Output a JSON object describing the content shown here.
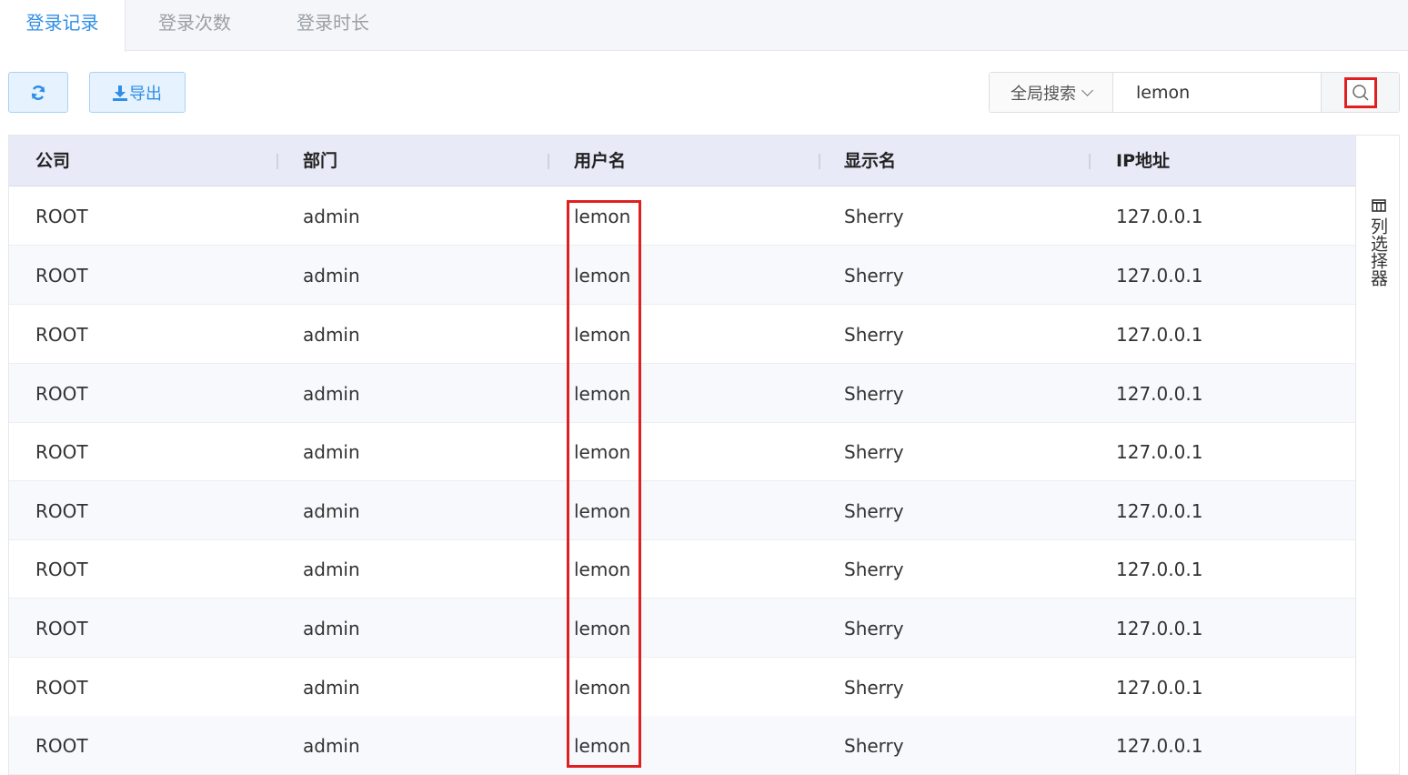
{
  "tabs": [
    {
      "label": "登录记录",
      "active": true
    },
    {
      "label": "登录次数",
      "active": false
    },
    {
      "label": "登录时长",
      "active": false
    }
  ],
  "toolbar": {
    "refresh_icon": "refresh-icon",
    "export_icon": "download-icon",
    "export_label": "导出"
  },
  "search": {
    "scope_label": "全局搜索",
    "value": "lemon",
    "search_icon": "search-icon"
  },
  "table": {
    "columns": [
      "公司",
      "部门",
      "用户名",
      "显示名",
      "IP地址"
    ],
    "rows": [
      [
        "ROOT",
        "admin",
        "lemon",
        "Sherry",
        "127.0.0.1"
      ],
      [
        "ROOT",
        "admin",
        "lemon",
        "Sherry",
        "127.0.0.1"
      ],
      [
        "ROOT",
        "admin",
        "lemon",
        "Sherry",
        "127.0.0.1"
      ],
      [
        "ROOT",
        "admin",
        "lemon",
        "Sherry",
        "127.0.0.1"
      ],
      [
        "ROOT",
        "admin",
        "lemon",
        "Sherry",
        "127.0.0.1"
      ],
      [
        "ROOT",
        "admin",
        "lemon",
        "Sherry",
        "127.0.0.1"
      ],
      [
        "ROOT",
        "admin",
        "lemon",
        "Sherry",
        "127.0.0.1"
      ],
      [
        "ROOT",
        "admin",
        "lemon",
        "Sherry",
        "127.0.0.1"
      ],
      [
        "ROOT",
        "admin",
        "lemon",
        "Sherry",
        "127.0.0.1"
      ],
      [
        "ROOT",
        "admin",
        "lemon",
        "Sherry",
        "127.0.0.1"
      ]
    ]
  },
  "column_picker": {
    "icon": "columns-icon",
    "label": "列选择器"
  },
  "colors": {
    "accent": "#2f8ee6",
    "highlight": "#e02020",
    "header_bg": "#e8ebf7"
  }
}
